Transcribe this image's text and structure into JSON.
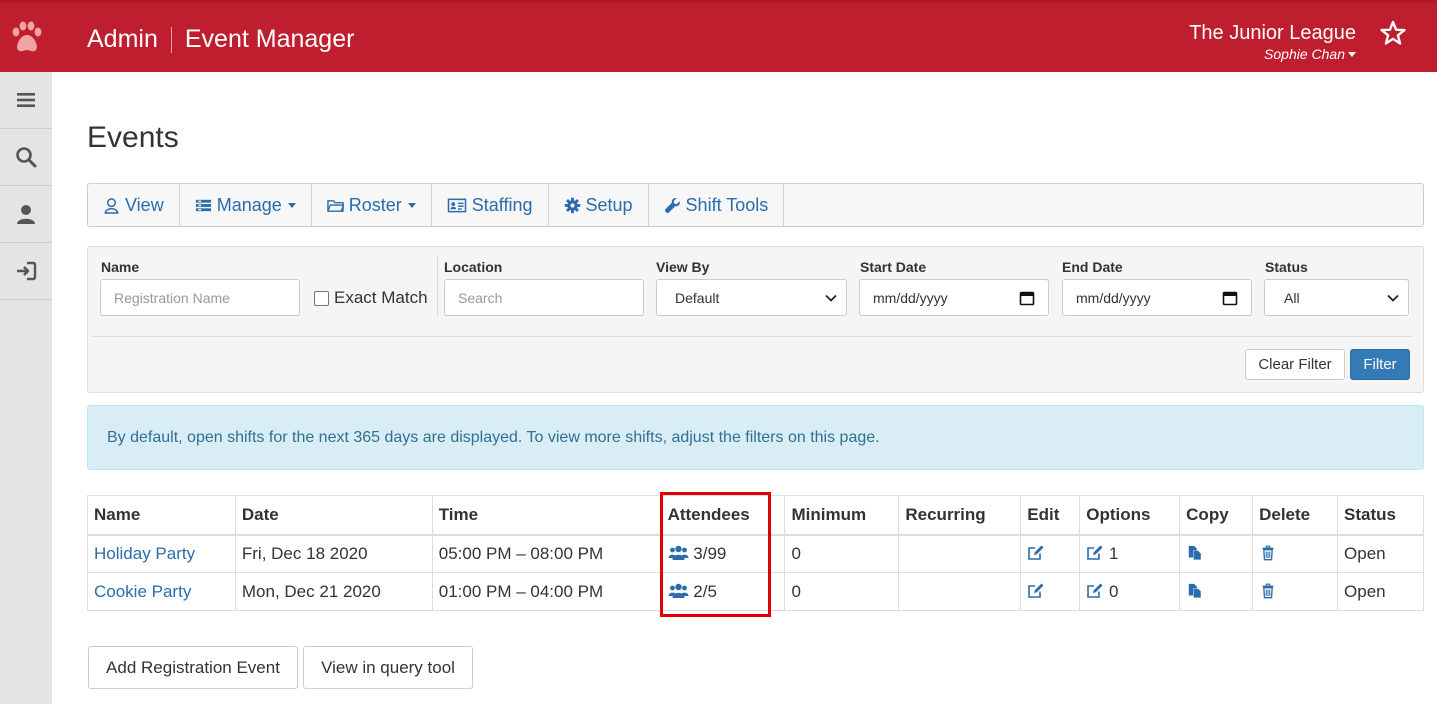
{
  "header": {
    "brand_left": "Admin",
    "brand_right": "Event Manager",
    "org_name": "The Junior League",
    "user_name": "Sophie Chan",
    "bg_color": "#bf1e2e"
  },
  "rail": {
    "items": [
      "menu-icon",
      "search-icon",
      "user-icon",
      "sign-in-icon"
    ]
  },
  "page": {
    "title": "Events"
  },
  "tabs": [
    {
      "label": "View",
      "icon": "user-outline-icon"
    },
    {
      "label": "Manage",
      "icon": "list-icon",
      "dropdown": true
    },
    {
      "label": "Roster",
      "icon": "folder-icon",
      "dropdown": true
    },
    {
      "label": "Staffing",
      "icon": "id-card-icon"
    },
    {
      "label": "Setup",
      "icon": "gear-icon"
    },
    {
      "label": "Shift Tools",
      "icon": "wrench-icon"
    }
  ],
  "filters": {
    "name_label": "Name",
    "name_placeholder": "Registration Name",
    "exact_match_label": "Exact Match",
    "location_label": "Location",
    "location_placeholder": "Search",
    "view_by_label": "View By",
    "view_by_value": "Default",
    "start_date_label": "Start Date",
    "start_date_value": "mm/dd/yyyy",
    "end_date_label": "End Date",
    "end_date_value": "mm/dd/yyyy",
    "status_label": "Status",
    "status_value": "All",
    "clear_label": "Clear Filter",
    "filter_label": "Filter"
  },
  "alert": {
    "text": "By default, open shifts for the next 365 days are displayed. To view more shifts, adjust the filters on this page."
  },
  "table": {
    "headers": [
      "Name",
      "Date",
      "Time",
      "Attendees",
      "Minimum",
      "Recurring",
      "Edit",
      "Options",
      "Copy",
      "Delete",
      "Status"
    ],
    "rows": [
      {
        "name": "Holiday Party",
        "date": "Fri, Dec 18 2020",
        "time": "05:00 PM – 08:00 PM",
        "attendees": "3/99",
        "minimum": "0",
        "recurring": "",
        "options": "1",
        "status": "Open"
      },
      {
        "name": "Cookie Party",
        "date": "Mon, Dec 21 2020",
        "time": "01:00 PM – 04:00 PM",
        "attendees": "2/5",
        "minimum": "0",
        "recurring": "",
        "options": "0",
        "status": "Open"
      }
    ]
  },
  "actions": {
    "add_label": "Add Registration Event",
    "query_label": "View in query tool"
  },
  "colors": {
    "link": "#2a6cad",
    "highlight": "#e00000",
    "alert_bg": "#d9edf7"
  }
}
